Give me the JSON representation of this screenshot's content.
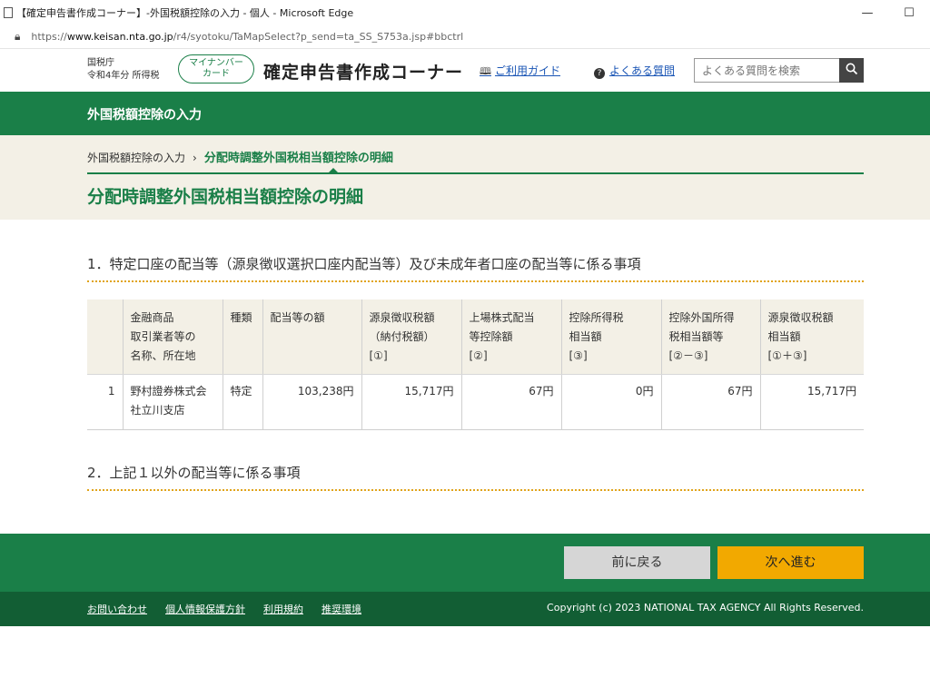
{
  "window": {
    "title": "【確定申告書作成コーナー】-外国税額控除の入力 - 個人 - Microsoft Edge",
    "minimize_glyph": "—",
    "maximize_glyph": "☐"
  },
  "address_bar": {
    "url_prefix": "https://",
    "url_domain": "www.keisan.nta.go.jp",
    "url_rest": "/r4/syotoku/TaMapSelect?p_send=ta_SS_S753a.jsp#bbctrl"
  },
  "header": {
    "agency": "国税庁",
    "year_tax": "令和4年分 所得税",
    "mynumber_line1": "マイナンバー",
    "mynumber_line2": "カード",
    "site_title": "確定申告書作成コーナー",
    "guide_label": "ご利用ガイド",
    "faq_label": "よくある質問",
    "search_placeholder": "よくある質問を検索"
  },
  "green_bar": {
    "label": "外国税額控除の入力"
  },
  "breadcrumb": {
    "parent": "外国税額控除の入力",
    "separator": "›",
    "current": "分配時調整外国税相当額控除の明細"
  },
  "page_title": "分配時調整外国税相当額控除の明細",
  "section1": {
    "heading": "1．特定口座の配当等（源泉徴収選択口座内配当等）及び未成年者口座の配当等に係る事項",
    "table": {
      "headers": [
        {
          "l1": "",
          "l2": "",
          "l3": ""
        },
        {
          "l1": "金融商品",
          "l2": "取引業者等の",
          "l3": "名称、所在地"
        },
        {
          "l1": "種類",
          "l2": "",
          "l3": ""
        },
        {
          "l1": "配当等の額",
          "l2": "",
          "l3": ""
        },
        {
          "l1": "源泉徴収税額",
          "l2": "（納付税額）",
          "l3": "[①]"
        },
        {
          "l1": "上場株式配当",
          "l2": "等控除額",
          "l3": "[②]"
        },
        {
          "l1": "控除所得税",
          "l2": "相当額",
          "l3": "[③]"
        },
        {
          "l1": "控除外国所得",
          "l2": "税相当額等",
          "l3": "[②－③]"
        },
        {
          "l1": "源泉徴収税額",
          "l2": "相当額",
          "l3": "[①＋③]"
        }
      ],
      "rows": [
        {
          "no": "1",
          "name_l1": "野村證券株式会",
          "name_l2": "社立川支店",
          "type": "特定",
          "dividend": "103,238円",
          "withholding": "15,717円",
          "listed_deduction": "67円",
          "income_tax_equiv": "0円",
          "foreign_tax_equiv": "67円",
          "withholding_equiv": "15,717円"
        }
      ]
    }
  },
  "section2": {
    "heading": "2．上記１以外の配当等に係る事項"
  },
  "nav": {
    "back_label": "前に戻る",
    "next_label": "次へ進む"
  },
  "footer": {
    "links": [
      "お問い合わせ",
      "個人情報保護方針",
      "利用規約",
      "推奨環境"
    ],
    "copyright": "Copyright (c) 2023 NATIONAL TAX AGENCY All Rights Reserved."
  },
  "colors": {
    "brand_green": "#1a7f48",
    "dark_green": "#125e34",
    "beige": "#f3f0e6",
    "next_button": "#f2a900",
    "back_button": "#d6d6d6"
  }
}
